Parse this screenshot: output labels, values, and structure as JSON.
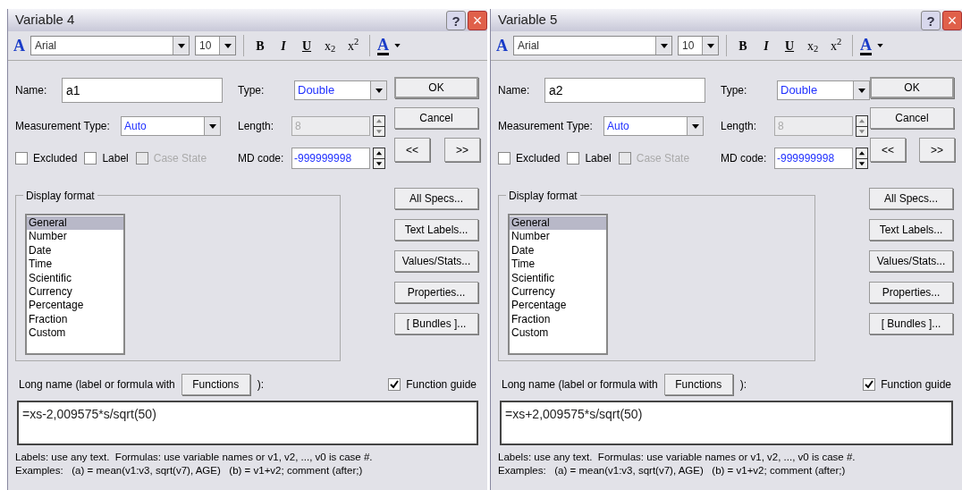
{
  "dialogs": [
    {
      "title": "Variable 4",
      "help": "?",
      "close": "×",
      "font_icon": "A",
      "font": "Arial",
      "size": "10",
      "format_buttons": [
        "B",
        "I",
        "U",
        "x$_{2}$",
        "x$^{2}$"
      ],
      "color_button": "A",
      "name_label": "Name:",
      "name_value": "a1",
      "type_label": "Type:",
      "type_value": "Double",
      "measurement_label": "Measurement Type:",
      "measurement_value": "Auto",
      "length_label": "Length:",
      "length_value": "8",
      "md_label": "MD code:",
      "md_value": "-999999998",
      "checkboxes": [
        {
          "label": "Excluded",
          "checked": false,
          "disabled": false
        },
        {
          "label": "Label",
          "checked": false,
          "disabled": false
        },
        {
          "label": "Case State",
          "checked": false,
          "disabled": true
        }
      ],
      "display_format": {
        "title": "Display format",
        "items": [
          {
            "label": "General",
            "selected": true
          },
          {
            "label": "Number",
            "selected": false
          },
          {
            "label": "Date",
            "selected": false
          },
          {
            "label": "Time",
            "selected": false
          },
          {
            "label": "Scientific",
            "selected": false
          },
          {
            "label": "Currency",
            "selected": false
          },
          {
            "label": "Percentage",
            "selected": false
          },
          {
            "label": "Fraction",
            "selected": false
          },
          {
            "label": "Custom",
            "selected": false
          }
        ]
      },
      "buttons": [
        "OK",
        "Cancel"
      ],
      "nav_buttons": [
        "<<",
        ">>"
      ],
      "side_buttons": [
        "All Specs...",
        "Text Labels...",
        "Values/Stats...",
        "Properties...",
        "[ Bundles ]..."
      ],
      "long_name_label": "Long name (label or formula with",
      "functions_button": "Functions",
      "long_name_end": "):",
      "function_guide": {
        "label": "Function guide",
        "checked": true
      },
      "formula": "=xs-2,009575*s/sqrt(50)",
      "help_lines": [
        "Labels: use any text.  Formulas: use variable names or v1, v2, ..., v0 is case #.",
        "Examples:   (a) = mean(v1:v3, sqrt(v7), AGE)   (b) = v1+v2; comment (after;)"
      ]
    },
    {
      "title": "Variable 5",
      "help": "?",
      "close": "×",
      "font_icon": "A",
      "font": "Arial",
      "size": "10",
      "format_buttons": [
        "B",
        "I",
        "U",
        "x$_{2}$",
        "x$^{2}$"
      ],
      "color_button": "A",
      "name_label": "Name:",
      "name_value": "a2",
      "type_label": "Type:",
      "type_value": "Double",
      "measurement_label": "Measurement Type:",
      "measurement_value": "Auto",
      "length_label": "Length:",
      "length_value": "8",
      "md_label": "MD code:",
      "md_value": "-999999998",
      "checkboxes": [
        {
          "label": "Excluded",
          "checked": false,
          "disabled": false
        },
        {
          "label": "Label",
          "checked": false,
          "disabled": false
        },
        {
          "label": "Case State",
          "checked": false,
          "disabled": true
        }
      ],
      "display_format": {
        "title": "Display format",
        "items": [
          {
            "label": "General",
            "selected": true
          },
          {
            "label": "Number",
            "selected": false
          },
          {
            "label": "Date",
            "selected": false
          },
          {
            "label": "Time",
            "selected": false
          },
          {
            "label": "Scientific",
            "selected": false
          },
          {
            "label": "Currency",
            "selected": false
          },
          {
            "label": "Percentage",
            "selected": false
          },
          {
            "label": "Fraction",
            "selected": false
          },
          {
            "label": "Custom",
            "selected": false
          }
        ]
      },
      "buttons": [
        "OK",
        "Cancel"
      ],
      "nav_buttons": [
        "<<",
        ">>"
      ],
      "side_buttons": [
        "All Specs...",
        "Text Labels...",
        "Values/Stats...",
        "Properties...",
        "[ Bundles ]..."
      ],
      "long_name_label": "Long name (label or formula with",
      "functions_button": "Functions",
      "long_name_end": "):",
      "function_guide": {
        "label": "Function guide",
        "checked": true
      },
      "formula": "=xs+2,009575*s/sqrt(50)",
      "help_lines": [
        "Labels: use any text.  Formulas: use variable names or v1, v2, ..., v0 is case #.",
        "Examples:   (a) = mean(v1:v3, sqrt(v7), AGE)   (b) = v1+v2; comment (after;)"
      ]
    }
  ]
}
